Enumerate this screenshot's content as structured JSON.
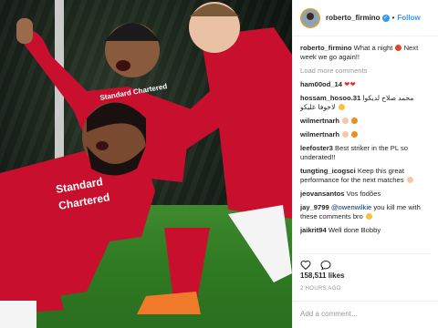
{
  "post": {
    "username": "roberto_firmino",
    "follow_label": "Follow",
    "separator": "•",
    "likes": "158,511 likes",
    "time": "2 HOURS AGO",
    "add_comment_placeholder": "Add a comment...",
    "load_more": "Load more comments",
    "caption": {
      "user": "roberto_firmino",
      "text": "What a night",
      "text2": "Next week we go again!!"
    },
    "comments": [
      {
        "user": "ham00od_14",
        "text": ""
      },
      {
        "user": "hossam_hosoo.31",
        "text": "محمد صلاح لديكوا لاخوفا عليكو"
      },
      {
        "user": "wilmertnarh",
        "text": ""
      },
      {
        "user": "wilmertnarh",
        "text": ""
      },
      {
        "user": "leefoster3",
        "text": "Best striker in the PL so underated!!"
      },
      {
        "user": "tungting_icogsci",
        "text": "Keep this great performance for the next matches"
      },
      {
        "user": "jeovansantos",
        "text": "Vos fodões"
      },
      {
        "user": "jay_9799",
        "mention": "@owenwilkie",
        "text": "you kill me with these comments bro"
      },
      {
        "user": "jaikrit94",
        "text": "Well done Bobby"
      }
    ]
  },
  "photo": {
    "jersey_text_1": "Standard",
    "jersey_text_2": "Chartered",
    "jersey_text_3": "Standard Chartered"
  },
  "colors": {
    "accent": "#3897f0",
    "kit_red": "#c8102e"
  }
}
